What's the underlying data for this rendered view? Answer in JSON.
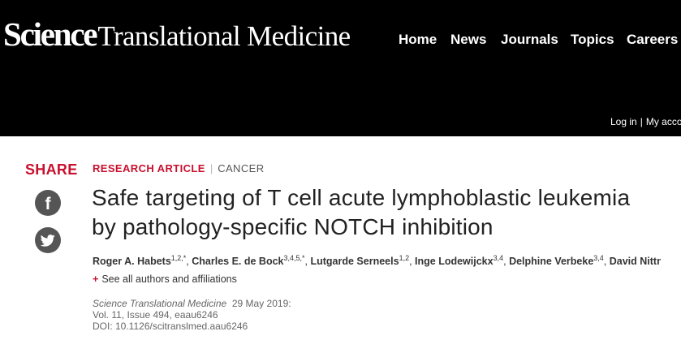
{
  "header": {
    "logo_bold": "Science",
    "logo_rest": "Translational Medicine",
    "nav": [
      "Home",
      "News",
      "Journals",
      "Topics",
      "Careers"
    ],
    "login": "Log in",
    "separator": "|",
    "account": "My accou"
  },
  "share": {
    "label": "SHARE",
    "facebook_glyph": "f"
  },
  "article": {
    "type": "RESEARCH ARTICLE",
    "divider": "|",
    "subject": "CANCER",
    "title_line1": "Safe targeting of T cell acute lymphoblastic leukemia",
    "title_line2": "by pathology-specific NOTCH inhibition",
    "authors": [
      {
        "name": "Roger A. Habets",
        "sup": "1,2,*"
      },
      {
        "name": "Charles E. de Bock",
        "sup": "3,4,5,*"
      },
      {
        "name": "Lutgarde Serneels",
        "sup": "1,2"
      },
      {
        "name": "Inge Lodewijckx",
        "sup": "3,4"
      },
      {
        "name": "Delphine Verbeke",
        "sup": "3,4"
      },
      {
        "name": "David Nittne…",
        "sup": ""
      }
    ],
    "see_all_plus": "+",
    "see_all": "See all authors and affiliations",
    "journal": "Science Translational Medicine",
    "date": "29 May 2019:",
    "volume": "Vol. 11, Issue 494, eaau6246",
    "doi": "DOI: 10.1126/scitranslmed.aau6246"
  },
  "colors": {
    "accent": "#c8102e",
    "header_bg": "#000000",
    "icon_bg": "#555555"
  }
}
